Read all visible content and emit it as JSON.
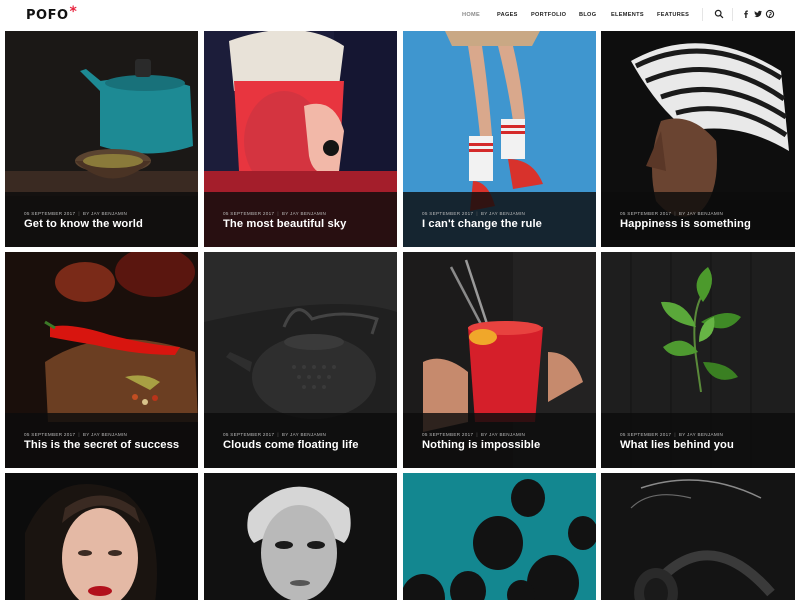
{
  "brand": {
    "name": "POFO",
    "mark": "*",
    "accent": "#e8233e"
  },
  "nav": {
    "items": [
      {
        "label": "HOME",
        "active": true
      },
      {
        "label": "PAGES",
        "active": false
      },
      {
        "label": "PORTFOLIO",
        "active": false
      },
      {
        "label": "BLOG",
        "active": false
      },
      {
        "label": "ELEMENTS",
        "active": false
      },
      {
        "label": "FEATURES",
        "active": false
      }
    ],
    "icons": [
      "search-icon",
      "facebook-icon",
      "twitter-icon",
      "pinterest-icon"
    ]
  },
  "posts": [
    {
      "date": "05 SEPTEMBER 2017",
      "author": "BY JAY BENJAMIN",
      "title": "Get to know the world",
      "image": "teapot-and-cup-photo"
    },
    {
      "date": "05 SEPTEMBER 2017",
      "author": "BY JAY BENJAMIN",
      "title": "The most beautiful sky",
      "image": "woman-red-light-photo"
    },
    {
      "date": "05 SEPTEMBER 2017",
      "author": "BY JAY BENJAMIN",
      "title": "I can't change the rule",
      "image": "legs-red-socks-photo"
    },
    {
      "date": "05 SEPTEMBER 2017",
      "author": "BY JAY BENJAMIN",
      "title": "Happiness is something",
      "image": "woman-striped-hat-photo"
    },
    {
      "date": "05 SEPTEMBER 2017",
      "author": "BY JAY BENJAMIN",
      "title": "This is the secret of success",
      "image": "red-chili-board-photo"
    },
    {
      "date": "05 SEPTEMBER 2017",
      "author": "BY JAY BENJAMIN",
      "title": "Clouds come floating life",
      "image": "black-teapot-photo"
    },
    {
      "date": "05 SEPTEMBER 2017",
      "author": "BY JAY BENJAMIN",
      "title": "Nothing is impossible",
      "image": "red-drink-glass-photo"
    },
    {
      "date": "05 SEPTEMBER 2017",
      "author": "BY JAY BENJAMIN",
      "title": "What lies behind you",
      "image": "basil-leaves-photo"
    },
    {
      "date": "",
      "author": "",
      "title": "",
      "image": "woman-red-lips-photo"
    },
    {
      "date": "",
      "author": "",
      "title": "",
      "image": "woman-bw-portrait-photo"
    },
    {
      "date": "",
      "author": "",
      "title": "",
      "image": "black-balloons-photo"
    },
    {
      "date": "",
      "author": "",
      "title": "",
      "image": "headphones-photo"
    }
  ]
}
